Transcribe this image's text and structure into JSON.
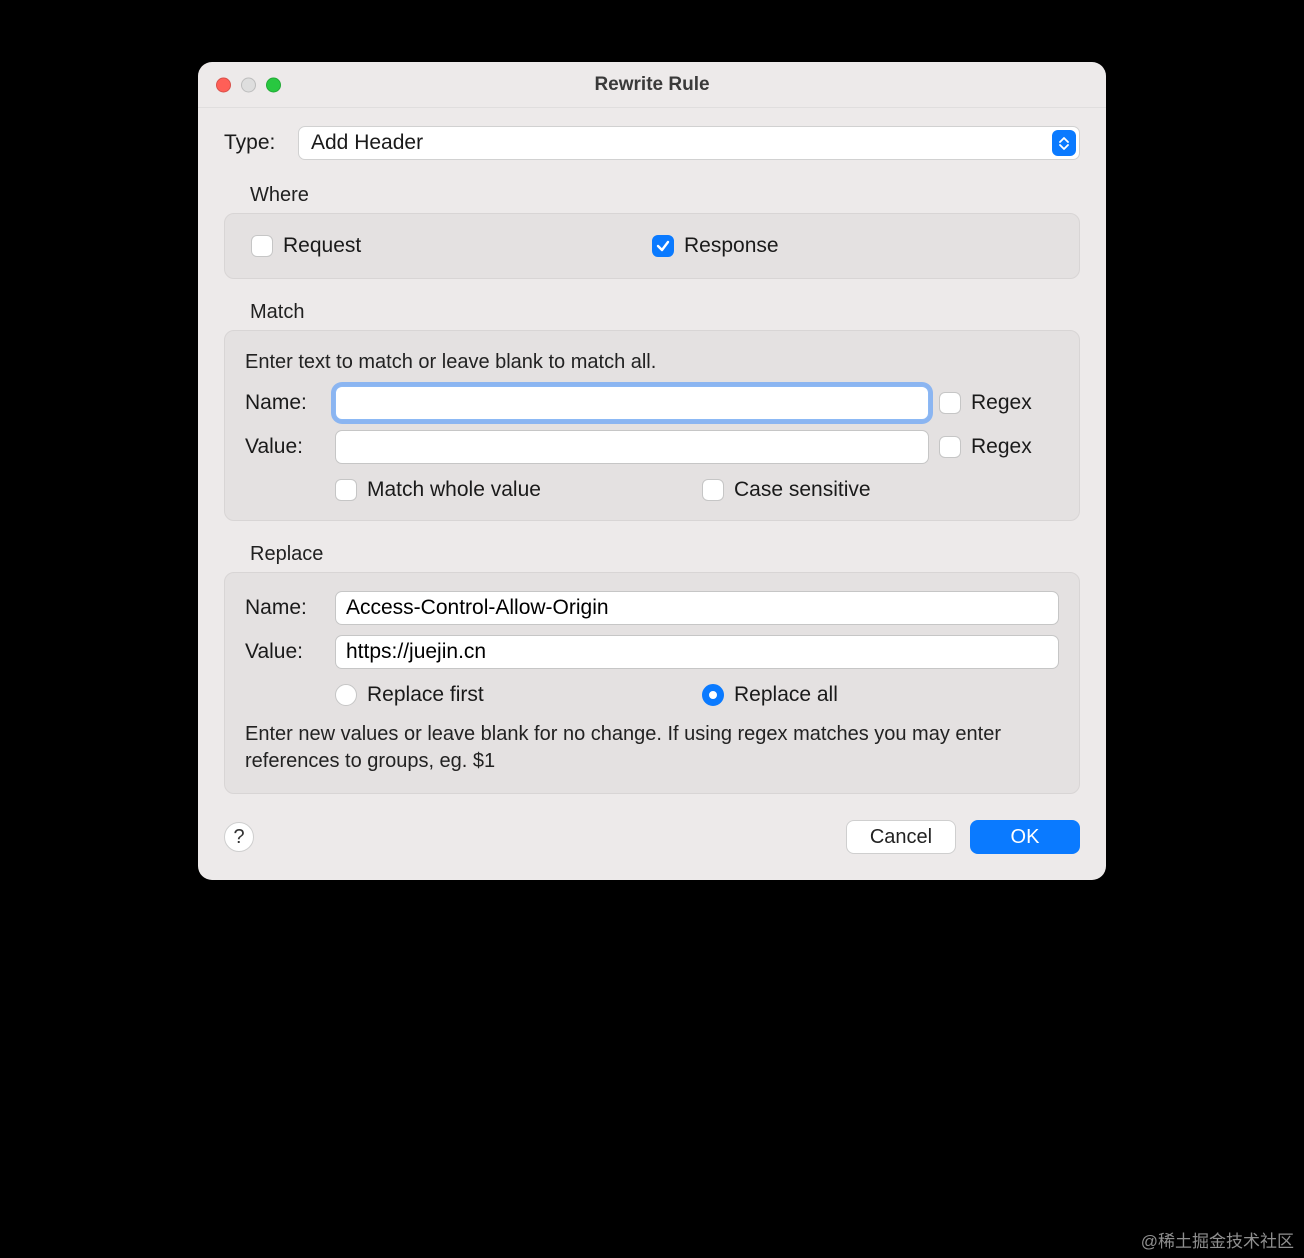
{
  "window": {
    "title": "Rewrite Rule"
  },
  "type": {
    "label": "Type:",
    "selected": "Add Header"
  },
  "where": {
    "section_label": "Where",
    "request_label": "Request",
    "request_checked": false,
    "response_label": "Response",
    "response_checked": true
  },
  "match": {
    "section_label": "Match",
    "instruction": "Enter text to match or leave blank to match all.",
    "name_label": "Name:",
    "name_value": "",
    "value_label": "Value:",
    "value_value": "",
    "regex_label": "Regex",
    "match_whole_label": "Match whole value",
    "match_whole_checked": false,
    "case_sensitive_label": "Case sensitive",
    "case_sensitive_checked": false,
    "name_regex_checked": false,
    "value_regex_checked": false
  },
  "replace": {
    "section_label": "Replace",
    "name_label": "Name:",
    "name_value": "Access-Control-Allow-Origin",
    "value_label": "Value:",
    "value_value": "https://juejin.cn",
    "replace_first_label": "Replace first",
    "replace_all_label": "Replace all",
    "mode": "all",
    "help_text": "Enter new values or leave blank for no change. If using regex matches you may enter references to groups, eg. $1"
  },
  "footer": {
    "help_glyph": "?",
    "cancel_label": "Cancel",
    "ok_label": "OK"
  },
  "watermark": "@稀土掘金技术社区"
}
